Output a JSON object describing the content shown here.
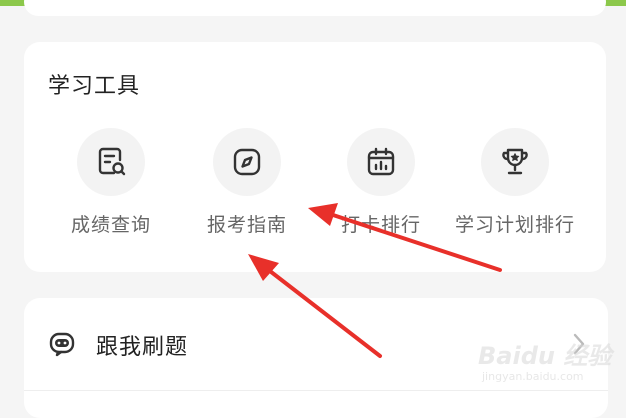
{
  "tools": {
    "title": "学习工具",
    "items": [
      {
        "label": "成绩查询",
        "icon": "score-search-icon"
      },
      {
        "label": "报考指南",
        "icon": "compass-icon"
      },
      {
        "label": "打卡排行",
        "icon": "calendar-chart-icon"
      },
      {
        "label": "学习计划排行",
        "icon": "trophy-icon"
      }
    ]
  },
  "practice": {
    "label": "跟我刷题",
    "icon": "robot-chat-icon"
  },
  "watermark": {
    "brand": "Baidu 经验",
    "url": "jingyan.baidu.com"
  },
  "colors": {
    "accent": "#8cc84b",
    "annotation": "#e8302a",
    "icon": "#333333"
  }
}
